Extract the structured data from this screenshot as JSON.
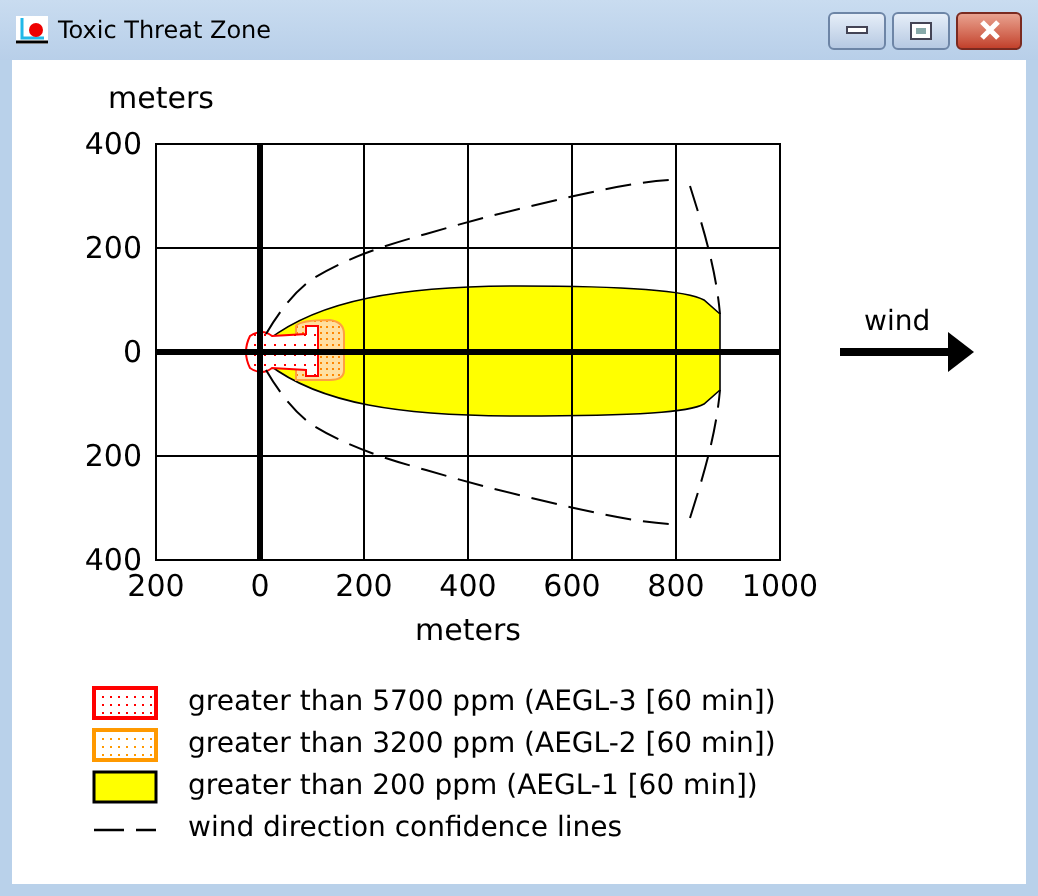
{
  "window": {
    "title": "Toxic Threat Zone"
  },
  "plot": {
    "y_unit": "meters",
    "y_tick_labels": [
      "400",
      "200",
      "0",
      "200",
      "400"
    ],
    "x_tick_labels": [
      "200",
      "0",
      "200",
      "400",
      "600",
      "800",
      "1000"
    ],
    "x_label": "meters",
    "wind_label": "wind"
  },
  "legend": [
    {
      "kind": "dotted",
      "color": "#ff0000",
      "label": "greater than 5700 ppm (AEGL-3 [60 min])"
    },
    {
      "kind": "dotted",
      "color": "#ff9900",
      "label": "greater than 3200 ppm (AEGL-2 [60 min])"
    },
    {
      "kind": "solid",
      "color": "#ffff00",
      "label": "greater than 200 ppm (AEGL-1 [60 min])"
    },
    {
      "kind": "dashed",
      "label": "wind direction confidence lines"
    }
  ]
}
